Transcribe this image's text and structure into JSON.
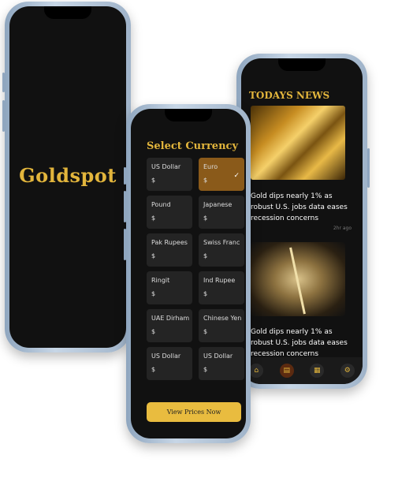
{
  "splash": {
    "logo": "Goldspot"
  },
  "currency": {
    "title": "Select Currency",
    "tiles": [
      {
        "name": "US Dollar",
        "symbol": "$"
      },
      {
        "name": "Euro",
        "symbol": "$",
        "selected": true
      },
      {
        "name": "Pound",
        "symbol": "$"
      },
      {
        "name": "Japanese",
        "symbol": "$"
      },
      {
        "name": "Pak Rupees",
        "symbol": "$"
      },
      {
        "name": "Swiss Franc",
        "symbol": "$"
      },
      {
        "name": "Ringit",
        "symbol": "$"
      },
      {
        "name": "Ind Rupee",
        "symbol": "$"
      },
      {
        "name": "UAE Dirham",
        "symbol": "$"
      },
      {
        "name": "Chinese Yen",
        "symbol": "$"
      },
      {
        "name": "US Dollar",
        "symbol": "$"
      },
      {
        "name": "US Dollar",
        "symbol": "$"
      }
    ],
    "check": "✓",
    "button": "View Prices Now"
  },
  "news": {
    "title": "TODAYS NEWS",
    "articles": [
      {
        "headline": "Gold dips nearly 1% as robust U.S. jobs data eases recession concerns",
        "ago": "2hr ago"
      },
      {
        "headline": "Gold dips nearly 1% as robust U.S. jobs data eases recession concerns"
      }
    ],
    "nav_icons": [
      "home-icon",
      "document-icon",
      "calculator-icon",
      "settings-icon"
    ]
  },
  "colors": {
    "gold": "#e2b53c",
    "selected": "#8a5a1a",
    "button": "#e9bc3f"
  }
}
